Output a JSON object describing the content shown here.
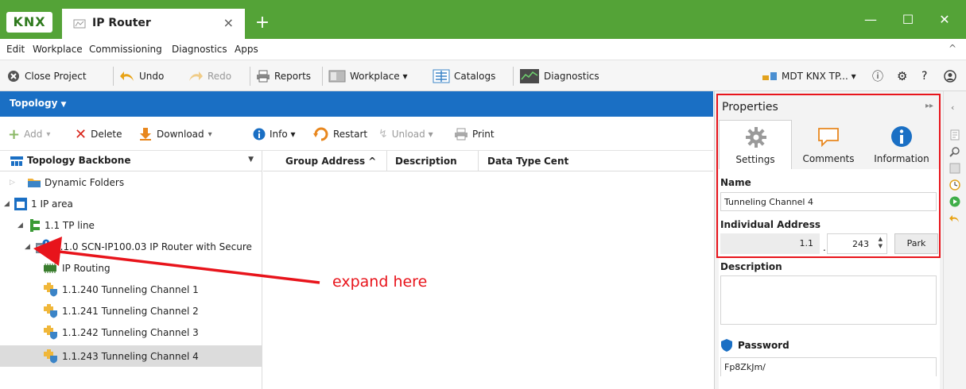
{
  "window": {
    "logo": "KNX",
    "tab_title": "IP Router",
    "tab_close": "×",
    "new_tab": "+",
    "controls": {
      "minimize": "—",
      "maximize": "☐",
      "close": "✕"
    }
  },
  "menu": {
    "items": [
      "Edit",
      "Workplace",
      "Commissioning",
      "Diagnostics",
      "Apps"
    ],
    "collapse": "^"
  },
  "toolbar": {
    "close_project": "Close Project",
    "undo": "Undo",
    "redo": "Redo",
    "reports": "Reports",
    "workplace": "Workplace ▾",
    "catalogs": "Catalogs",
    "diagnostics": "Diagnostics",
    "interface": "MDT KNX TP... ▾"
  },
  "topology": {
    "title": "Topology",
    "actions": {
      "add": "Add",
      "delete": "Delete",
      "download": "Download",
      "info": "Info ▾",
      "restart": "Restart",
      "unload": "Unload ▾",
      "print": "Print"
    },
    "tree_header": "Topology Backbone",
    "tree": [
      "Dynamic Folders",
      "1 IP area",
      "1.1 TP line",
      "1.1.0 SCN-IP100.03 IP Router with Secure",
      "IP Routing",
      "1.1.240 Tunneling Channel 1",
      "1.1.241 Tunneling Channel 2",
      "1.1.242 Tunneling Channel 3",
      "1.1.243 Tunneling Channel 4"
    ],
    "grid_columns": [
      "Group Address ^",
      "Description",
      "Data Type",
      "Cent"
    ]
  },
  "annotation": {
    "text": "expand here",
    "color": "#e8141b"
  },
  "properties": {
    "title": "Properties",
    "expand": "▸▸",
    "tabs": [
      "Settings",
      "Comments",
      "Information"
    ],
    "active_tab": "Settings",
    "name_label": "Name",
    "name_value": "Tunneling Channel 4",
    "address_label": "Individual Address",
    "address_prefix": "1.1",
    "address_sep": ".",
    "address_value": "243",
    "park_button": "Park",
    "description_label": "Description",
    "description_value": "",
    "password_label": "Password",
    "password_value": "Fp8ZkJm/"
  },
  "colors": {
    "titlebar": "#54a337",
    "topology_header": "#1a6fc4",
    "highlight": "#e8141b"
  }
}
